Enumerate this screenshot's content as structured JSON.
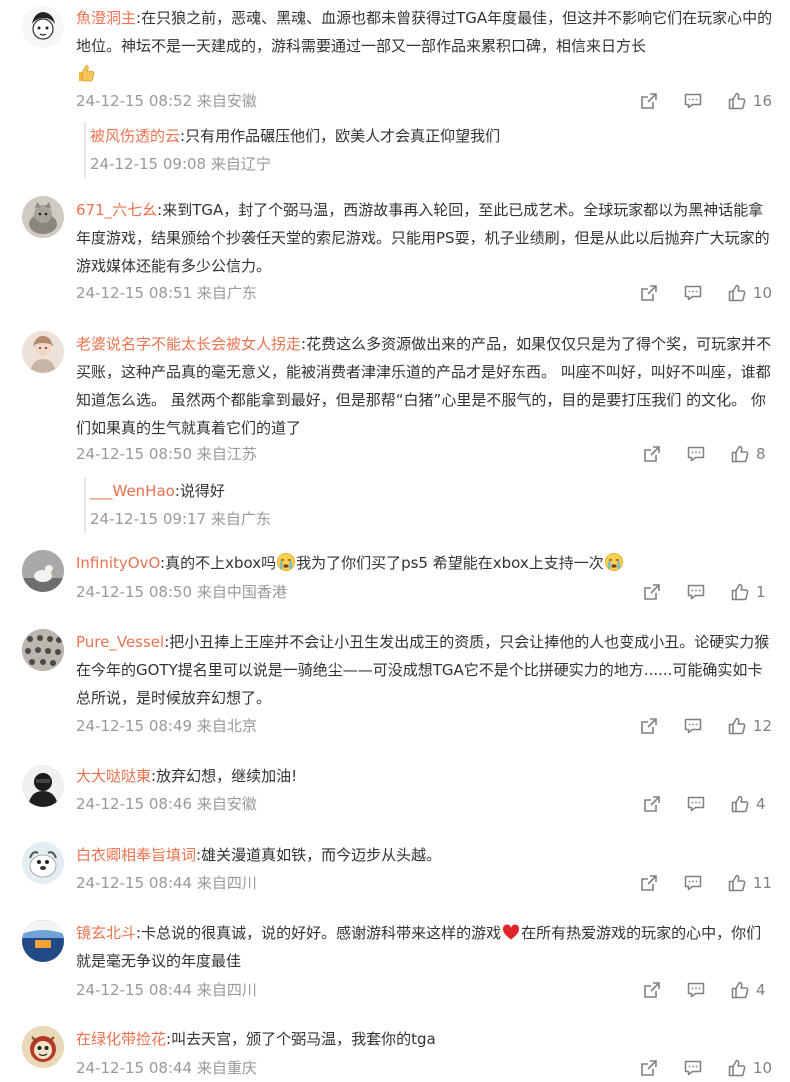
{
  "comments": [
    {
      "user": "魚澄洞主",
      "text": ":在只狼之前，恶魂、黑魂、血源也都未曾获得过TGA年度最佳，但这并不影响它们在玩家心中的地位。神坛不是一天建成的，游科需要通过一部又一部作品来累积口碑，相信来日方长",
      "emoji": "thumbs-up",
      "meta": "24-12-15 08:52 来自安徽",
      "likes": "16",
      "reply": {
        "user": "被风伤透的云",
        "text": ":只有用作品碾压他们，欧美人才会真正仰望我们",
        "meta": "24-12-15 09:08 来自辽宁"
      }
    },
    {
      "user": "671_六七幺",
      "text": ":来到TGA，封了个弼马温，西游故事再入轮回，至此已成艺术。全球玩家都以为黑神话能拿年度游戏，结果颁给个抄袭任天堂的索尼游戏。只能用PS耍，机子业绩刷，但是从此以后抛弃广大玩家的游戏媒体还能有多少公信力。",
      "meta": "24-12-15 08:51 来自广东",
      "likes": "10"
    },
    {
      "user": "老婆说名字不能太长会被女人拐走",
      "text": ":花费这么多资源做出来的产品，如果仅仅只是为了得个奖，可玩家并不买账，这种产品真的毫无意义，能被消费者津津乐道的产品才是好东西。 叫座不叫好，叫好不叫座，谁都知道怎么选。 虽然两个都能拿到最好，但是那帮“白猪”心里是不服气的，目的是要打压我们 的文化。 你们如果真的生气就真着它们的道了",
      "meta": "24-12-15 08:50 来自江苏",
      "likes": "8",
      "reply": {
        "user": "___WenHao",
        "text": ":说得好",
        "meta": "24-12-15 09:17 来自广东"
      }
    },
    {
      "user": "InfinityOvO",
      "text1": ":真的不上xbox吗",
      "text2": "我为了你们买了ps5 希望能在xbox上支持一次",
      "meta": "24-12-15 08:50 来自中国香港",
      "likes": "1"
    },
    {
      "user": "Pure_Vessel",
      "text": ":把小丑捧上王座并不会让小丑生发出成王的资质，只会让捧他的人也变成小丑。论硬实力猴在今年的GOTY提名里可以说是一骑绝尘——可没成想TGA它不是个比拼硬实力的地方......可能确实如卡总所说，是时候放弃幻想了。",
      "meta": "24-12-15 08:49 来自北京",
      "likes": "12"
    },
    {
      "user": "大大哒哒東",
      "text": ":放弃幻想，继续加油!",
      "meta": "24-12-15 08:46 来自安徽",
      "likes": "4"
    },
    {
      "user": "白衣卿相奉旨填词",
      "text": ":雄关漫道真如铁，而今迈步从头越。",
      "meta": "24-12-15 08:44 来自四川",
      "likes": "11"
    },
    {
      "user": "镜玄北斗",
      "text1": ":卡总说的很真诚，说的好好。感谢游科带来这样的游戏",
      "text2": "在所有热爱游戏的玩家的心中，你们就是毫无争议的年度最佳",
      "meta": "24-12-15 08:44 来自四川",
      "likes": "4"
    },
    {
      "user": "在绿化带捡花",
      "text": ":叫去天宫，颁了个弼马温，我套你的tga",
      "meta": "24-12-15 08:44 来自重庆",
      "likes": "10"
    }
  ],
  "colors": {
    "username": "#eb7350",
    "meta": "#999999",
    "text": "#333333"
  }
}
